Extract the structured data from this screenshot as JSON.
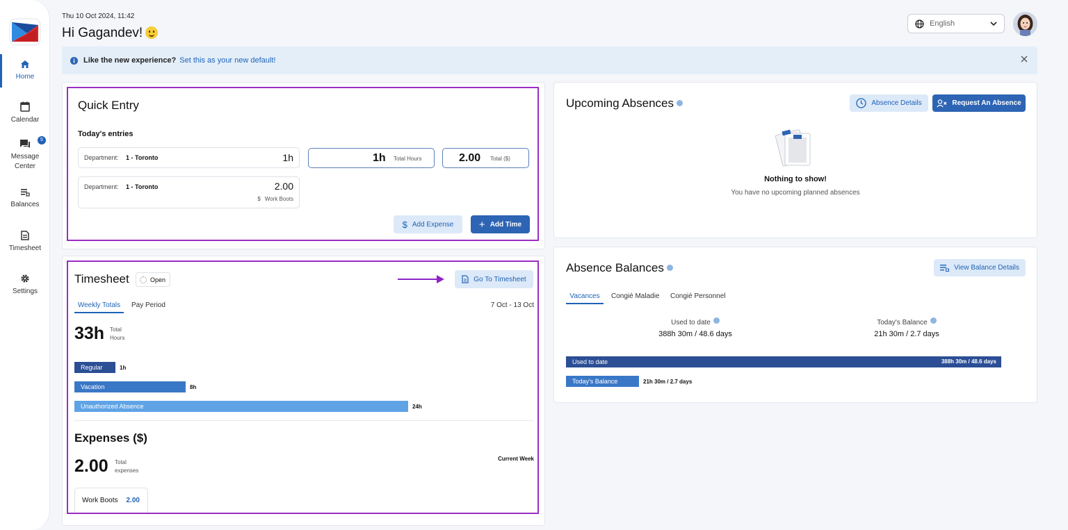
{
  "sidebar": {
    "items": [
      {
        "label": "Home"
      },
      {
        "label": "Calendar"
      },
      {
        "label": "Message Center",
        "badge": "5"
      },
      {
        "label": "Balances"
      },
      {
        "label": "Timesheet"
      },
      {
        "label": "Settings"
      }
    ]
  },
  "header": {
    "date": "Thu 10 Oct 2024, 11:42",
    "greeting": "Hi Gagandev!",
    "language": "English"
  },
  "banner": {
    "question": "Like the new experience?",
    "link": "Set this as your new default!"
  },
  "quick_entry": {
    "title": "Quick Entry",
    "subtitle": "Today's entries",
    "entries": [
      {
        "label": "Department:",
        "dept": "1 - Toronto",
        "value": "1h"
      },
      {
        "label": "Department:",
        "dept": "1 - Toronto",
        "value": "2.00",
        "sub": "Work Boots"
      }
    ],
    "total_hours": {
      "value": "1h",
      "label": "Total Hours"
    },
    "total_dollars": {
      "value": "2.00",
      "label": "Total ($)"
    },
    "add_expense": "Add Expense",
    "add_time": "Add Time"
  },
  "timesheet": {
    "title": "Timesheet",
    "status": "Open",
    "go_button": "Go To Timesheet",
    "tabs": [
      "Weekly Totals",
      "Pay Period"
    ],
    "range": "7 Oct - 13 Oct",
    "total": "33h",
    "total_label_1": "Total",
    "total_label_2": "Hours",
    "bars": [
      {
        "label": "Regular",
        "value": "1h",
        "hours": 1,
        "color": "#2b4e95"
      },
      {
        "label": "Vacation",
        "value": "8h",
        "hours": 8,
        "color": "#3a78c7"
      },
      {
        "label": "Unauthorized Absence",
        "value": "24h",
        "hours": 24,
        "color": "#5fa3e6"
      }
    ],
    "expenses_title": "Expenses ($)",
    "expenses_total": "2.00",
    "expenses_label_1": "Total",
    "expenses_label_2": "expenses",
    "current_week": "Current Week",
    "expense_item": {
      "name": "Work Boots",
      "amount": "2.00"
    }
  },
  "upcoming": {
    "title": "Upcoming Absences",
    "details_button": "Absence Details",
    "request_button": "Request An Absence",
    "empty_title": "Nothing to show!",
    "empty_text": "You have no upcoming planned absences"
  },
  "balances": {
    "title": "Absence Balances",
    "view_button": "View Balance Details",
    "tabs": [
      "Vacances",
      "Congié Maladie",
      "Congié Personnel"
    ],
    "used_label": "Used to date",
    "used_value": "388h 30m / 48.6 days",
    "today_label": "Today's Balance",
    "today_value": "21h 30m / 2.7 days",
    "bar_used_label": "Used to date",
    "bar_used_value": "388h 30m / 48.6 days",
    "bar_today_label": "Today's Balance",
    "bar_today_value": "21h 30m / 2.7 days",
    "used_fraction": 1.0,
    "today_fraction": 0.168
  },
  "colors": {
    "accent": "#1f62b6",
    "highlight": "#9b2cc3",
    "annotation_arrow": "#8e24c4"
  }
}
